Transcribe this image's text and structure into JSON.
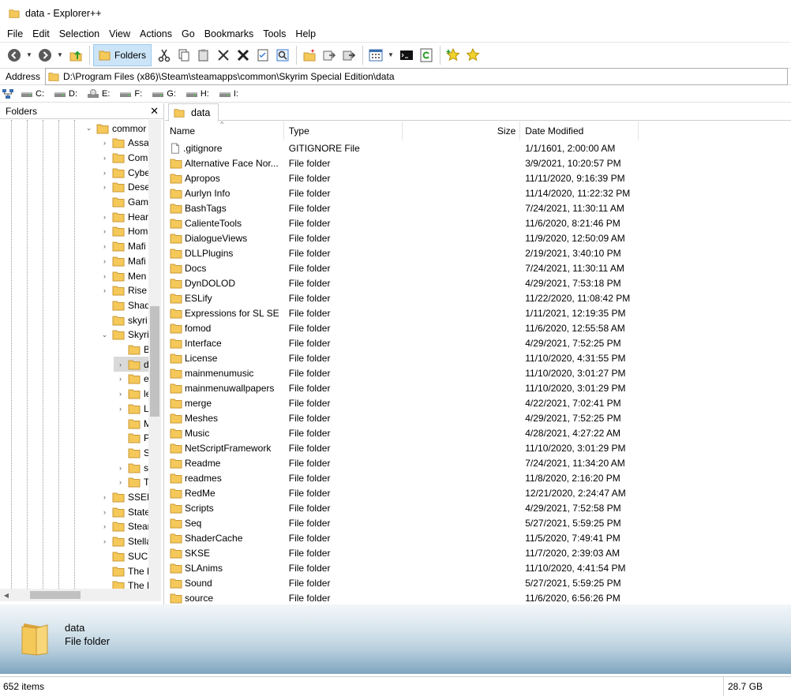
{
  "window": {
    "title": "data - Explorer++"
  },
  "menu": [
    "File",
    "Edit",
    "Selection",
    "View",
    "Actions",
    "Go",
    "Bookmarks",
    "Tools",
    "Help"
  ],
  "toolbar": {
    "folders_label": "Folders"
  },
  "address": {
    "label": "Address",
    "path": "D:\\Program Files (x86)\\Steam\\steamapps\\common\\Skyrim Special Edition\\data"
  },
  "drives": [
    "C:",
    "D:",
    "E:",
    "F:",
    "G:",
    "H:",
    "I:"
  ],
  "folders_pane": {
    "title": "Folders",
    "tree": [
      {
        "label": "commor",
        "level": 0,
        "expander": "open"
      },
      {
        "label": "Assa",
        "level": 1,
        "expander": "closed"
      },
      {
        "label": "Com",
        "level": 1,
        "expander": "closed"
      },
      {
        "label": "Cybe",
        "level": 1,
        "expander": "closed"
      },
      {
        "label": "Dese",
        "level": 1,
        "expander": "closed"
      },
      {
        "label": "Gam",
        "level": 1,
        "expander": "none"
      },
      {
        "label": "Hear",
        "level": 1,
        "expander": "closed"
      },
      {
        "label": "Hom",
        "level": 1,
        "expander": "closed"
      },
      {
        "label": "Mafi",
        "level": 1,
        "expander": "closed"
      },
      {
        "label": "Mafi",
        "level": 1,
        "expander": "closed"
      },
      {
        "label": "Men",
        "level": 1,
        "expander": "closed"
      },
      {
        "label": "Rise",
        "level": 1,
        "expander": "closed"
      },
      {
        "label": "Shad",
        "level": 1,
        "expander": "none"
      },
      {
        "label": "skyri",
        "level": 1,
        "expander": "none"
      },
      {
        "label": "Skyri",
        "level": 1,
        "expander": "open"
      },
      {
        "label": "B",
        "level": 2,
        "expander": "none"
      },
      {
        "label": "d",
        "level": 2,
        "expander": "closed",
        "selected": true
      },
      {
        "label": "e",
        "level": 2,
        "expander": "closed"
      },
      {
        "label": "le",
        "level": 2,
        "expander": "closed"
      },
      {
        "label": "L",
        "level": 2,
        "expander": "closed"
      },
      {
        "label": "M",
        "level": 2,
        "expander": "none"
      },
      {
        "label": "P",
        "level": 2,
        "expander": "none"
      },
      {
        "label": "S",
        "level": 2,
        "expander": "none"
      },
      {
        "label": "s",
        "level": 2,
        "expander": "closed"
      },
      {
        "label": "T",
        "level": 2,
        "expander": "closed"
      },
      {
        "label": "SSEE",
        "level": 1,
        "expander": "closed"
      },
      {
        "label": "State",
        "level": 1,
        "expander": "closed"
      },
      {
        "label": "Stear",
        "level": 1,
        "expander": "closed"
      },
      {
        "label": "Stella",
        "level": 1,
        "expander": "closed"
      },
      {
        "label": "SUCC",
        "level": 1,
        "expander": "none"
      },
      {
        "label": "The F",
        "level": 1,
        "expander": "none"
      },
      {
        "label": "The F",
        "level": 1,
        "expander": "none"
      },
      {
        "label": "The V",
        "level": 1,
        "expander": "closed"
      }
    ]
  },
  "tab": {
    "label": "data"
  },
  "columns": {
    "name": "Name",
    "type": "Type",
    "size": "Size",
    "date": "Date Modified"
  },
  "files": [
    {
      "name": ".gitignore",
      "type": "GITIGNORE File",
      "date": "1/1/1601, 2:00:00 AM",
      "icon": "file-icon"
    },
    {
      "name": "Alternative Face Nor...",
      "type": "File folder",
      "date": "3/9/2021, 10:20:57 PM",
      "icon": "folder-icon"
    },
    {
      "name": "Apropos",
      "type": "File folder",
      "date": "11/11/2020, 9:16:39 PM",
      "icon": "folder-icon"
    },
    {
      "name": "Aurlyn Info",
      "type": "File folder",
      "date": "11/14/2020, 11:22:32 PM",
      "icon": "folder-icon"
    },
    {
      "name": "BashTags",
      "type": "File folder",
      "date": "7/24/2021, 11:30:11 AM",
      "icon": "folder-icon"
    },
    {
      "name": "CalienteTools",
      "type": "File folder",
      "date": "11/6/2020, 8:21:46 PM",
      "icon": "folder-icon"
    },
    {
      "name": "DialogueViews",
      "type": "File folder",
      "date": "11/9/2020, 12:50:09 AM",
      "icon": "folder-icon"
    },
    {
      "name": "DLLPlugins",
      "type": "File folder",
      "date": "2/19/2021, 3:40:10 PM",
      "icon": "folder-icon"
    },
    {
      "name": "Docs",
      "type": "File folder",
      "date": "7/24/2021, 11:30:11 AM",
      "icon": "folder-icon"
    },
    {
      "name": "DynDOLOD",
      "type": "File folder",
      "date": "4/29/2021, 7:53:18 PM",
      "icon": "folder-icon"
    },
    {
      "name": "ESLify",
      "type": "File folder",
      "date": "11/22/2020, 11:08:42 PM",
      "icon": "folder-icon"
    },
    {
      "name": "Expressions for SL SE",
      "type": "File folder",
      "date": "1/11/2021, 12:19:35 PM",
      "icon": "folder-icon"
    },
    {
      "name": "fomod",
      "type": "File folder",
      "date": "11/6/2020, 12:55:58 AM",
      "icon": "folder-icon"
    },
    {
      "name": "Interface",
      "type": "File folder",
      "date": "4/29/2021, 7:52:25 PM",
      "icon": "folder-icon"
    },
    {
      "name": "License",
      "type": "File folder",
      "date": "11/10/2020, 4:31:55 PM",
      "icon": "folder-icon"
    },
    {
      "name": "mainmenumusic",
      "type": "File folder",
      "date": "11/10/2020, 3:01:27 PM",
      "icon": "folder-icon"
    },
    {
      "name": "mainmenuwallpapers",
      "type": "File folder",
      "date": "11/10/2020, 3:01:29 PM",
      "icon": "folder-icon"
    },
    {
      "name": "merge",
      "type": "File folder",
      "date": "4/22/2021, 7:02:41 PM",
      "icon": "folder-icon"
    },
    {
      "name": "Meshes",
      "type": "File folder",
      "date": "4/29/2021, 7:52:25 PM",
      "icon": "folder-icon"
    },
    {
      "name": "Music",
      "type": "File folder",
      "date": "4/28/2021, 4:27:22 AM",
      "icon": "folder-icon"
    },
    {
      "name": "NetScriptFramework",
      "type": "File folder",
      "date": "11/10/2020, 3:01:29 PM",
      "icon": "folder-icon"
    },
    {
      "name": "Readme",
      "type": "File folder",
      "date": "7/24/2021, 11:34:20 AM",
      "icon": "folder-icon"
    },
    {
      "name": "readmes",
      "type": "File folder",
      "date": "11/8/2020, 2:16:20 PM",
      "icon": "folder-icon"
    },
    {
      "name": "RedMe",
      "type": "File folder",
      "date": "12/21/2020, 2:24:47 AM",
      "icon": "folder-icon"
    },
    {
      "name": "Scripts",
      "type": "File folder",
      "date": "4/29/2021, 7:52:58 PM",
      "icon": "folder-icon"
    },
    {
      "name": "Seq",
      "type": "File folder",
      "date": "5/27/2021, 5:59:25 PM",
      "icon": "folder-icon"
    },
    {
      "name": "ShaderCache",
      "type": "File folder",
      "date": "11/5/2020, 7:49:41 PM",
      "icon": "folder-icon"
    },
    {
      "name": "SKSE",
      "type": "File folder",
      "date": "11/7/2020, 2:39:03 AM",
      "icon": "folder-icon"
    },
    {
      "name": "SLAnims",
      "type": "File folder",
      "date": "11/10/2020, 4:41:54 PM",
      "icon": "folder-icon"
    },
    {
      "name": "Sound",
      "type": "File folder",
      "date": "5/27/2021, 5:59:25 PM",
      "icon": "folder-icon"
    },
    {
      "name": "source",
      "type": "File folder",
      "date": "11/6/2020, 6:56:26 PM",
      "icon": "folder-icon"
    }
  ],
  "info_pane": {
    "name": "data",
    "type": "File folder"
  },
  "status": {
    "items": "652 items",
    "free": "28.7 GB"
  },
  "colors": {
    "folder": "#f5c85a",
    "folder_dark": "#dba43a",
    "selection": "#cce4f7",
    "info_gradient_end": "#7fa5bf"
  }
}
